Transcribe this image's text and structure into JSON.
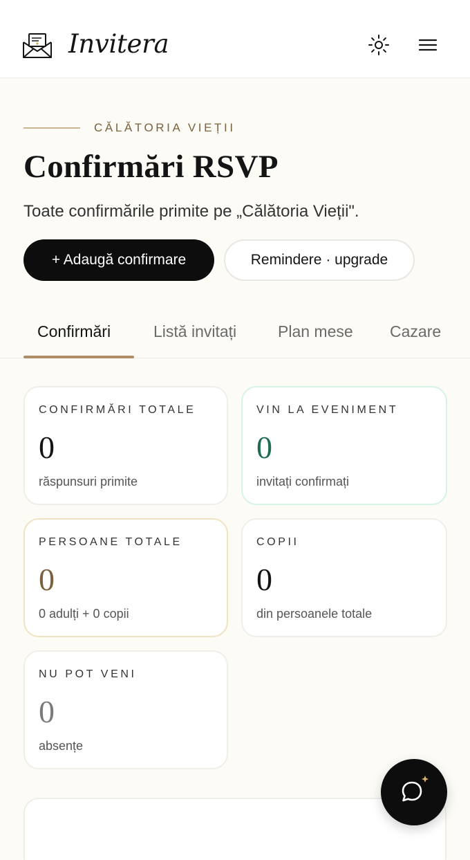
{
  "header": {
    "brand": "Invitera",
    "logo_icon": "envelope-icon",
    "theme_icon": "sun-icon",
    "menu_icon": "hamburger-menu-icon"
  },
  "hero": {
    "eyebrow": "CĂLĂTORIA VIEȚII",
    "title": "Confirmări RSVP",
    "subtitle": "Toate confirmările primite pe „Călătoria Vieții\"."
  },
  "actions": {
    "primary": "+ Adaugă confirmare",
    "secondary": "Remindere · upgrade"
  },
  "tabs": [
    {
      "label": "Confirmări",
      "active": true
    },
    {
      "label": "Listă invitați",
      "active": false
    },
    {
      "label": "Plan mese",
      "active": false
    },
    {
      "label": "Cazare",
      "active": false
    }
  ],
  "stats": [
    {
      "label": "CONFIRMĂRI TOTALE",
      "value": "0",
      "caption": "răspunsuri primite"
    },
    {
      "label": "VIN LA EVENIMENT",
      "value": "0",
      "caption": "invitați confirmați"
    },
    {
      "label": "PERSOANE TOTALE",
      "value": "0",
      "caption": "0 adulți + 0 copii"
    },
    {
      "label": "COPII",
      "value": "0",
      "caption": "din persoanele totale"
    },
    {
      "label": "NU POT VENI",
      "value": "0",
      "caption": "absențe"
    }
  ],
  "colors": {
    "accent_gold": "#b18c68",
    "eyebrow_brown": "#7a623f",
    "success_green": "#1f6b56",
    "background": "#fcfbf6"
  },
  "fab": {
    "icon": "chat-bubble-sparkle-icon"
  }
}
